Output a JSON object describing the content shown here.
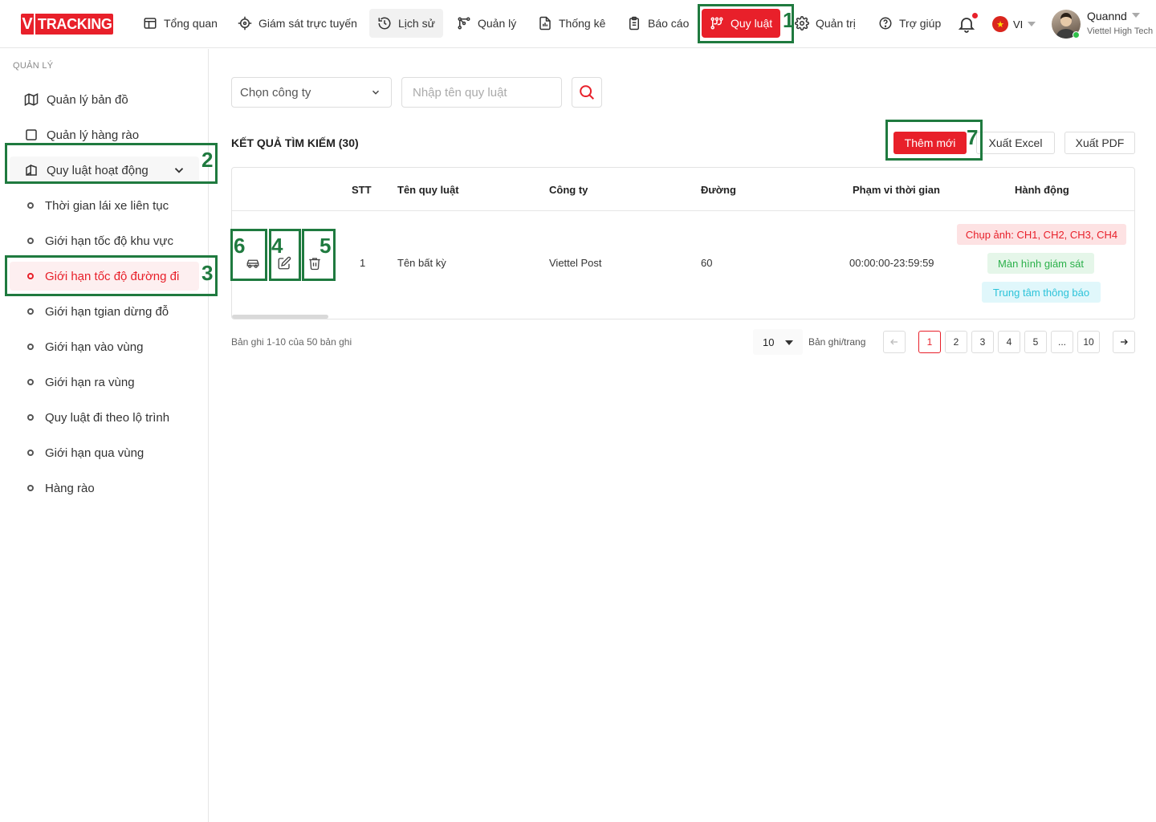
{
  "header": {
    "logo_v": "V",
    "logo_text": "TRACKING",
    "nav": [
      {
        "label": "Tổng quan",
        "icon": "dashboard-icon"
      },
      {
        "label": "Giám sát trực tuyến",
        "icon": "crosshair-icon"
      },
      {
        "label": "Lịch sử",
        "icon": "history-icon"
      },
      {
        "label": "Quản lý",
        "icon": "route-icon"
      },
      {
        "label": "Thống kê",
        "icon": "chart-file-icon"
      },
      {
        "label": "Báo cáo",
        "icon": "clipboard-icon"
      },
      {
        "label": "Quy luật",
        "icon": "rule-icon"
      },
      {
        "label": "Quản trị",
        "icon": "gear-icon"
      },
      {
        "label": "Trợ giúp",
        "icon": "help-icon"
      }
    ],
    "active_nav": "Quy luật",
    "language": "VI",
    "user_name": "Quannd",
    "user_org": "Viettel High Tech"
  },
  "sidebar": {
    "section": "QUẢN LÝ",
    "items": [
      {
        "label": "Quản lý bản đồ"
      },
      {
        "label": "Quản lý hàng rào"
      },
      {
        "label": "Quy luật hoạt động"
      }
    ],
    "sub_items": [
      {
        "label": "Thời gian lái xe liên tục"
      },
      {
        "label": "Giới hạn tốc độ khu vực"
      },
      {
        "label": "Giới hạn tốc độ đường đi"
      },
      {
        "label": "Giới hạn tgian dừng đỗ"
      },
      {
        "label": "Giới hạn vào vùng"
      },
      {
        "label": "Giới hạn ra vùng"
      },
      {
        "label": "Quy luật đi theo lộ trình"
      },
      {
        "label": "Giới hạn qua vùng"
      },
      {
        "label": "Hàng rào"
      }
    ],
    "active_sub": "Giới hạn tốc độ đường đi"
  },
  "filters": {
    "company_placeholder": "Chọn công ty",
    "rule_name_placeholder": "Nhập tên quy luật"
  },
  "results": {
    "title": "KẾT QUẢ TÌM KIẾM (30)",
    "add_label": "Thêm mới",
    "excel_label": "Xuất Excel",
    "pdf_label": "Xuất PDF"
  },
  "table": {
    "headers": [
      "STT",
      "Tên quy luật",
      "Công ty",
      "Đường",
      "Phạm vi thời gian",
      "Hành động"
    ],
    "rows": [
      {
        "stt": "1",
        "name": "Tên bất kỳ",
        "company": "Viettel Post",
        "road": "60",
        "time_range": "00:00:00-23:59:59",
        "actions": [
          "Chụp ảnh: CH1, CH2, CH3, CH4",
          "Màn hình giám sát",
          "Trung tâm thông báo"
        ]
      }
    ]
  },
  "annotations": [
    "1",
    "2",
    "3",
    "4",
    "5",
    "6",
    "7"
  ],
  "pagination": {
    "info": "Bản ghi 1-10 của 50 bản ghi",
    "page_size": "10",
    "per_page_label": "Bản ghi/trang",
    "pages": [
      "1",
      "2",
      "3",
      "4",
      "5",
      "...",
      "10"
    ],
    "current": "1"
  },
  "colors": {
    "brand": "#e8202a",
    "annotation": "#1f7a3f",
    "tag_green": "#2bb04a",
    "tag_cyan": "#2cc3d9"
  }
}
